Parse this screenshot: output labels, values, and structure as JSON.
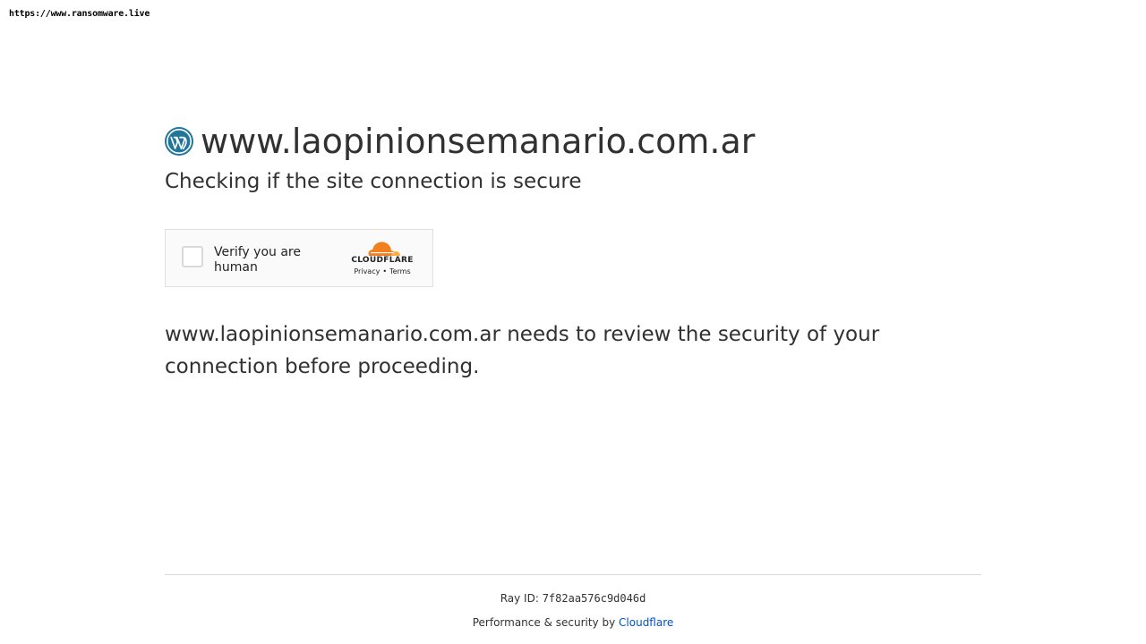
{
  "watermark": "https://www.ransomware.live",
  "site": {
    "icon": "wordpress-icon",
    "host": "www.laopinionsemanario.com.ar",
    "subtitle": "Checking if the site connection is secure"
  },
  "challenge": {
    "checkbox_label": "Verify you are human",
    "brand_icon": "cloudflare-cloud-icon",
    "brand_name": "CLOUDFLARE",
    "privacy_link": "Privacy",
    "separator": "•",
    "terms_link": "Terms",
    "brand_color": "#f38020"
  },
  "message": "www.laopinionsemanario.com.ar needs to review the security of your connection before proceeding.",
  "footer": {
    "ray_label": "Ray ID:",
    "ray_id": "7f82aa576c9d046d",
    "performance_text": "Performance & security by",
    "cloudflare_link": "Cloudflare",
    "link_color": "#0051c3"
  }
}
